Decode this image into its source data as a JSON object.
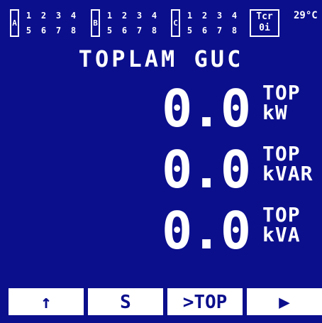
{
  "status": {
    "groups": [
      {
        "label": "A",
        "top": [
          "1",
          "2",
          "3",
          "4"
        ],
        "bottom": [
          "5",
          "6",
          "7",
          "8"
        ]
      },
      {
        "label": "B",
        "top": [
          "1",
          "2",
          "3",
          "4"
        ],
        "bottom": [
          "5",
          "6",
          "7",
          "8"
        ]
      },
      {
        "label": "C",
        "top": [
          "1",
          "2",
          "3",
          "4"
        ],
        "bottom": [
          "5",
          "6",
          "7",
          "8"
        ]
      }
    ],
    "tcr": {
      "line1": "Tcr",
      "line2": "0i"
    },
    "temperature": "29°C"
  },
  "page": {
    "title": "TOPLAM GUC"
  },
  "readings": [
    {
      "value": "0.0",
      "unit_top": "TOP",
      "unit_bottom": "kW"
    },
    {
      "value": "0.0",
      "unit_top": "TOP",
      "unit_bottom": "kVAR"
    },
    {
      "value": "0.0",
      "unit_top": "TOP",
      "unit_bottom": "kVA"
    }
  ],
  "softkeys": [
    "↑",
    "S",
    ">TOP",
    "▶"
  ],
  "colors": {
    "background": "#0b0f8c",
    "foreground": "#ffffff"
  }
}
